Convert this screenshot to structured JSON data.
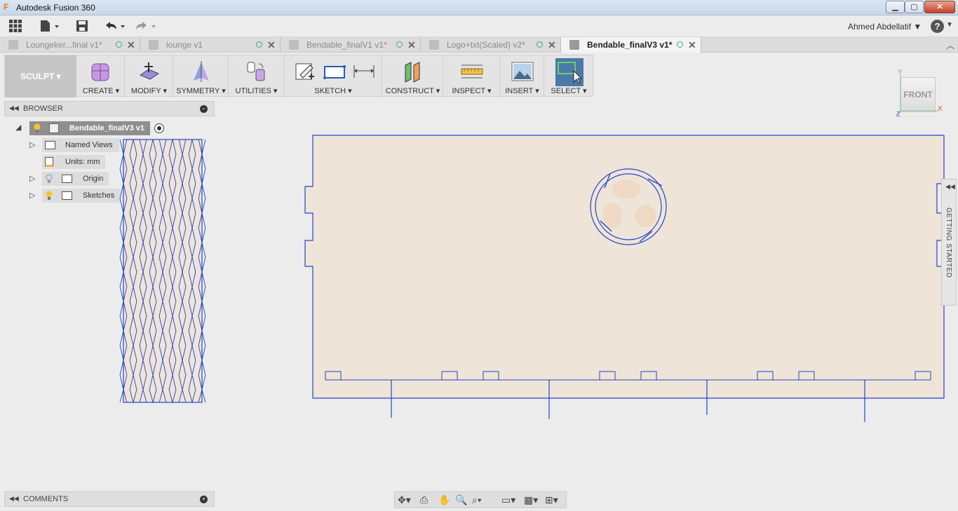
{
  "window": {
    "title": "Autodesk Fusion 360",
    "min": "▁",
    "max": "▢",
    "close": "✕"
  },
  "appbar": {
    "user": "Ahmed Abdellatif ▼",
    "help": "?"
  },
  "tabs": [
    {
      "label": "Loungeker...final v1*",
      "active": false
    },
    {
      "label": "lounge v1",
      "active": false
    },
    {
      "label": "Bendable_finalV1 v1*",
      "active": false
    },
    {
      "label": "Logo+txt(Scaled) v2*",
      "active": false
    },
    {
      "label": "Bendable_finalV3 v1*",
      "active": true
    }
  ],
  "toolbar": {
    "workspace": "SCULPT ▾",
    "groups": {
      "create": "CREATE ▾",
      "modify": "MODIFY ▾",
      "symmetry": "SYMMETRY ▾",
      "utilities": "UTILITIES ▾",
      "sketch": "SKETCH ▾",
      "construct": "CONSTRUCT ▾",
      "inspect": "INSPECT ▾",
      "insert": "INSERT ▾",
      "select": "SELECT ▾"
    }
  },
  "browser": {
    "header": "BROWSER",
    "root": "Bendable_finalV3 v1",
    "items": {
      "named_views": "Named Views",
      "units": "Units: mm",
      "origin": "Origin",
      "sketches": "Sketches"
    }
  },
  "comments": {
    "header": "COMMENTS"
  },
  "viewcube": {
    "face": "FRONT",
    "axis_y": "Y",
    "axis_x": "X",
    "axis_z": "Z"
  },
  "side_panel": {
    "label": "GETTING STARTED"
  },
  "colors": {
    "sketch_line": "#2146c8",
    "body_fill": "#efe4d8",
    "accent_select": "#4a7aa8"
  }
}
